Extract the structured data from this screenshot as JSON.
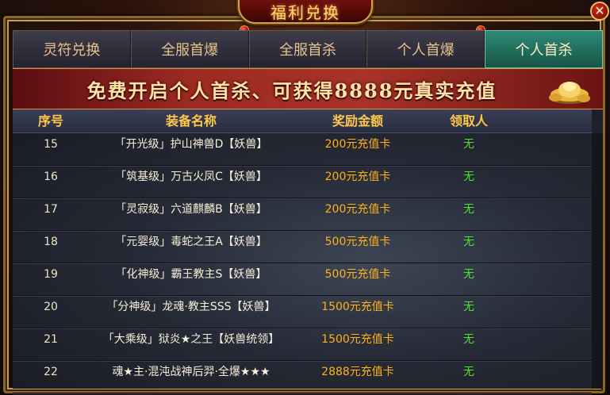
{
  "window": {
    "title": "福利兑换",
    "close_label": "✕"
  },
  "tabs": [
    {
      "label": "灵符兑换",
      "active": false
    },
    {
      "label": "全服首爆",
      "active": false
    },
    {
      "label": "全服首杀",
      "active": false
    },
    {
      "label": "个人首爆",
      "active": false
    },
    {
      "label": "个人首杀",
      "active": true
    }
  ],
  "banner": {
    "text": "免费开启个人首杀、可获得8888元真实充值",
    "icon": "gold-ingot-icon"
  },
  "table": {
    "headers": {
      "id": "序号",
      "name": "装备名称",
      "reward": "奖励金额",
      "claimer": "领取人"
    },
    "rows": [
      {
        "id": "15",
        "name": "「开光级」护山神兽D【妖兽】",
        "reward": "200元充值卡",
        "claimer": "无"
      },
      {
        "id": "16",
        "name": "「筑基级」万古火凤C【妖兽】",
        "reward": "200元充值卡",
        "claimer": "无"
      },
      {
        "id": "17",
        "name": "「灵寂级」六道麒麟B【妖兽】",
        "reward": "200元充值卡",
        "claimer": "无"
      },
      {
        "id": "18",
        "name": "「元婴级」毒蛇之王A【妖兽】",
        "reward": "500元充值卡",
        "claimer": "无"
      },
      {
        "id": "19",
        "name": "「化神级」霸王教主S【妖兽】",
        "reward": "500元充值卡",
        "claimer": "无"
      },
      {
        "id": "20",
        "name": "「分神级」龙魂·教主SSS【妖兽】",
        "reward": "1500元充值卡",
        "claimer": "无"
      },
      {
        "id": "21",
        "name": "「大乘级」狱炎★之王【妖兽统领】",
        "reward": "1500元充值卡",
        "claimer": "无"
      },
      {
        "id": "22",
        "name": "魂★主·混沌战神后羿·全爆★★★",
        "reward": "2888元充值卡",
        "claimer": "无"
      }
    ]
  },
  "colors": {
    "header_text": "#ffc848",
    "reward_text": "#ffb11a",
    "claimer_text": "#52e036",
    "active_tab": "#2f8a78",
    "banner": "#9c2a24"
  }
}
